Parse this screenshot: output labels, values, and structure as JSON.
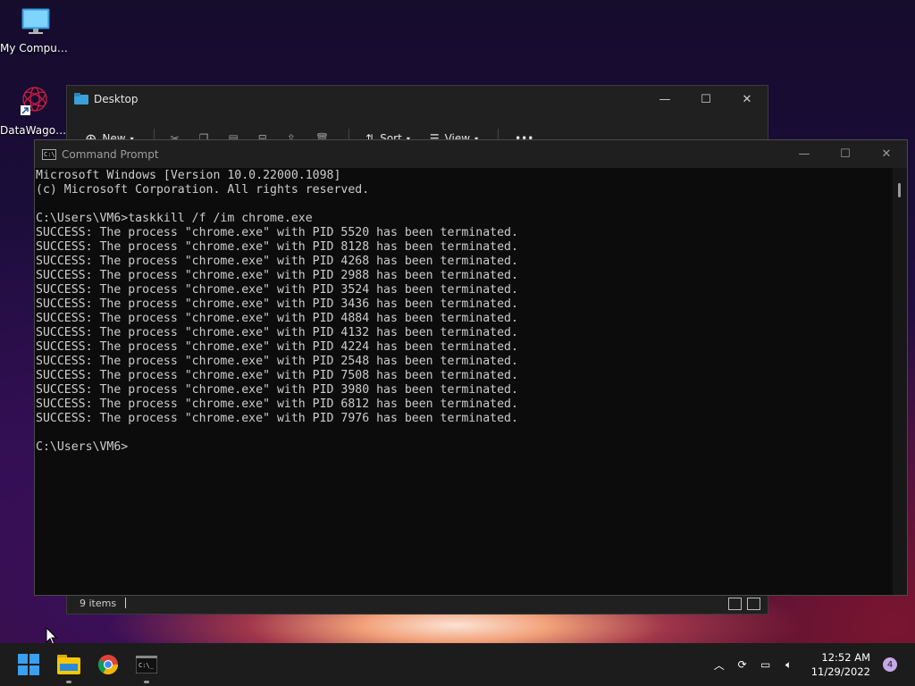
{
  "desktop_icons": [
    {
      "label": "My Computer",
      "icon": "monitor-icon"
    },
    {
      "label": "DataWagon...",
      "icon": "datawagon-shortcut-icon"
    }
  ],
  "explorer": {
    "title": "Desktop",
    "toolbar": {
      "new_label": "New",
      "sort_label": "Sort",
      "view_label": "View",
      "more": "•••"
    },
    "status_items": "9 items"
  },
  "cmd": {
    "title": "Command Prompt",
    "lines": [
      "Microsoft Windows [Version 10.0.22000.1098]",
      "(c) Microsoft Corporation. All rights reserved.",
      "",
      "C:\\Users\\VM6>taskkill /f /im chrome.exe",
      "SUCCESS: The process \"chrome.exe\" with PID 5520 has been terminated.",
      "SUCCESS: The process \"chrome.exe\" with PID 8128 has been terminated.",
      "SUCCESS: The process \"chrome.exe\" with PID 4268 has been terminated.",
      "SUCCESS: The process \"chrome.exe\" with PID 2988 has been terminated.",
      "SUCCESS: The process \"chrome.exe\" with PID 3524 has been terminated.",
      "SUCCESS: The process \"chrome.exe\" with PID 3436 has been terminated.",
      "SUCCESS: The process \"chrome.exe\" with PID 4884 has been terminated.",
      "SUCCESS: The process \"chrome.exe\" with PID 4132 has been terminated.",
      "SUCCESS: The process \"chrome.exe\" with PID 4224 has been terminated.",
      "SUCCESS: The process \"chrome.exe\" with PID 2548 has been terminated.",
      "SUCCESS: The process \"chrome.exe\" with PID 7508 has been terminated.",
      "SUCCESS: The process \"chrome.exe\" with PID 3980 has been terminated.",
      "SUCCESS: The process \"chrome.exe\" with PID 6812 has been terminated.",
      "SUCCESS: The process \"chrome.exe\" with PID 7976 has been terminated.",
      "",
      "C:\\Users\\VM6>"
    ]
  },
  "taskbar": {
    "apps": [
      "start-icon",
      "file-explorer-icon",
      "chrome-icon",
      "terminal-icon"
    ],
    "tray": {
      "time": "12:52 AM",
      "date": "11/29/2022",
      "notifications": "4"
    }
  },
  "colors": {
    "console_bg": "#0c0c0c",
    "console_fg": "#cccccc",
    "taskbar_bg": "#1c1c1c",
    "start_blue": "#3aa0f0"
  }
}
